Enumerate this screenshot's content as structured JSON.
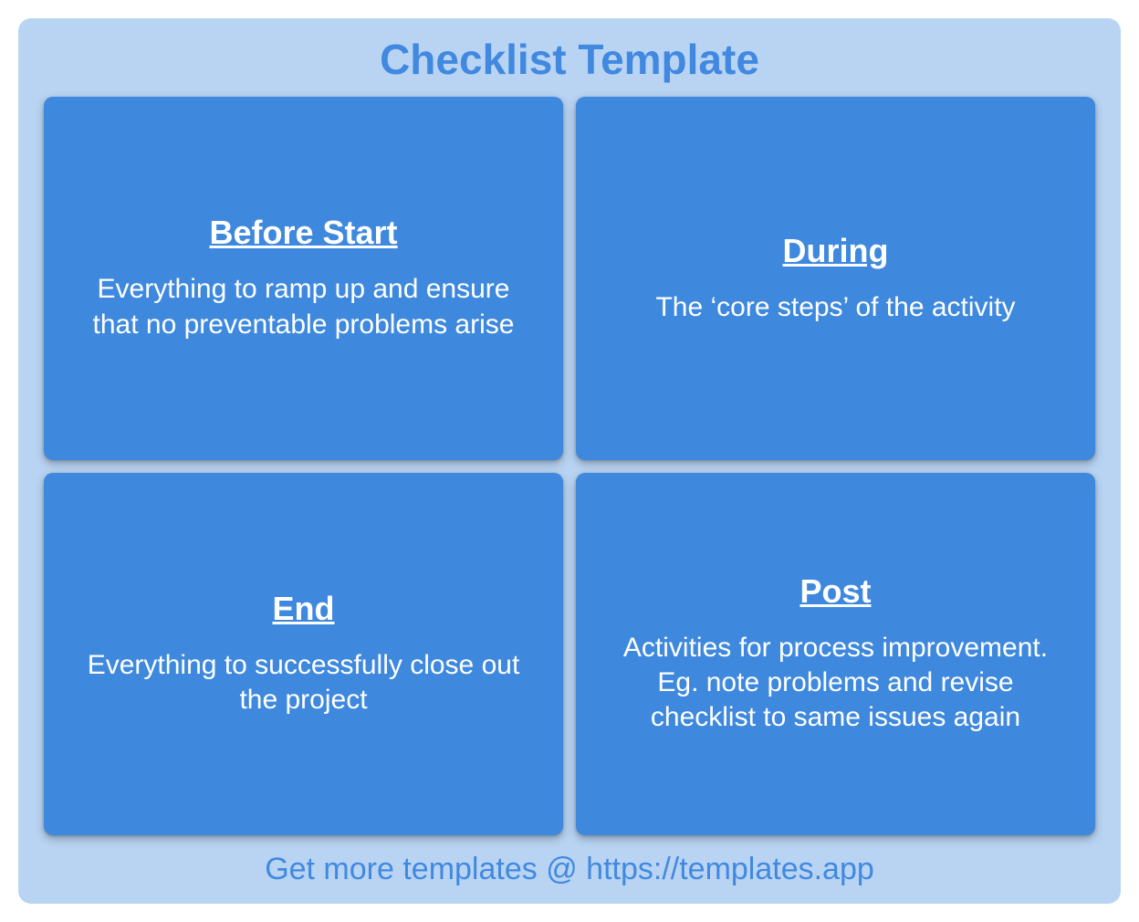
{
  "title": "Checklist Template",
  "cards": [
    {
      "heading": "Before Start",
      "description": "Everything to ramp up and ensure that no preventable problems arise"
    },
    {
      "heading": "During",
      "description": "The ‘core steps’ of the activity"
    },
    {
      "heading": "End",
      "description": "Everything to successfully close out the project"
    },
    {
      "heading": "Post",
      "description": "Activities for process improvement. Eg. note problems and revise checklist to same issues again"
    }
  ],
  "footer": "Get more templates @ https://templates.app"
}
